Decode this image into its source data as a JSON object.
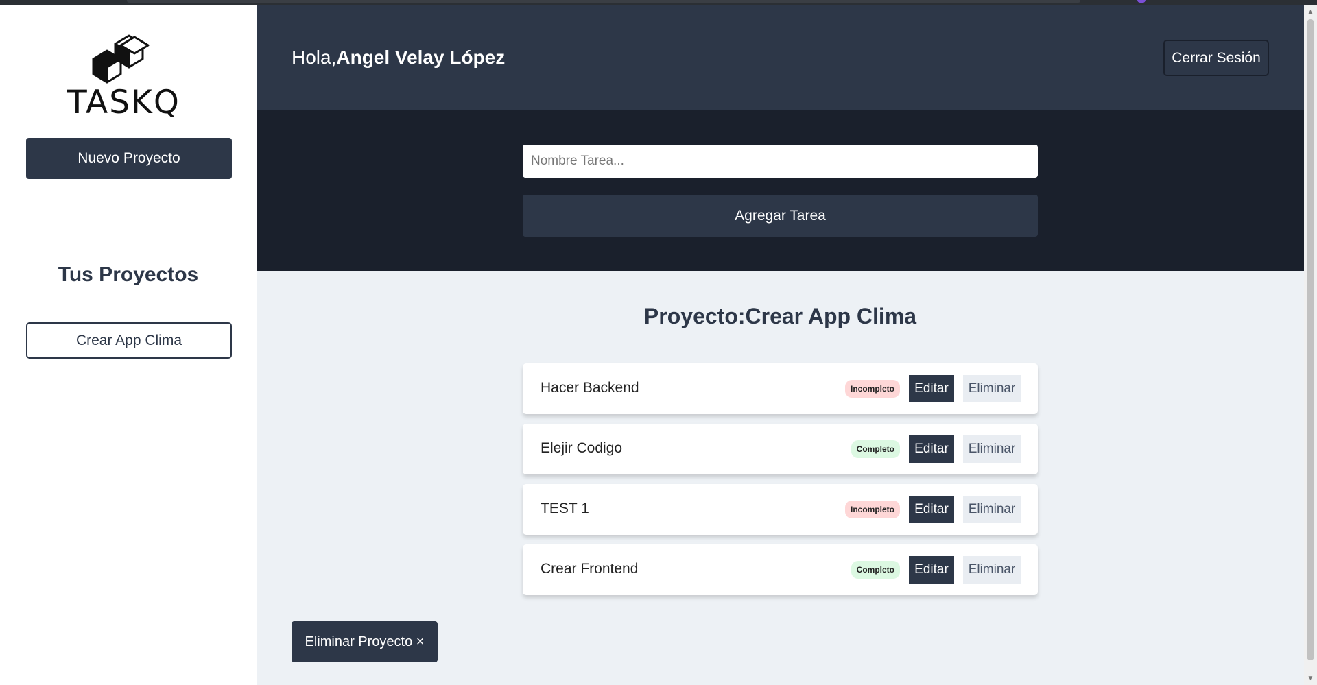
{
  "sidebar": {
    "logo_text": "TASKQ",
    "new_project_label": "Nuevo Proyecto",
    "projects_title": "Tus Proyectos",
    "projects": [
      {
        "name": "Crear App Clima"
      }
    ]
  },
  "header": {
    "greeting_prefix": "Hola,",
    "user_name": "Angel Velay López",
    "logout_label": "Cerrar Sesión"
  },
  "task_form": {
    "input_placeholder": "Nombre Tarea...",
    "input_value": "",
    "submit_label": "Agregar Tarea"
  },
  "project": {
    "title_prefix": "Proyecto:",
    "name": "Crear App Clima",
    "tasks": [
      {
        "name": "Hacer Backend",
        "status": "Incompleto",
        "edit_label": "Editar",
        "delete_label": "Eliminar"
      },
      {
        "name": "Elejir Codigo",
        "status": "Completo",
        "edit_label": "Editar",
        "delete_label": "Eliminar"
      },
      {
        "name": "TEST 1",
        "status": "Incompleto",
        "edit_label": "Editar",
        "delete_label": "Eliminar"
      },
      {
        "name": "Crear Frontend",
        "status": "Completo",
        "edit_label": "Editar",
        "delete_label": "Eliminar"
      }
    ],
    "delete_project_label": "Eliminar Proyecto ×"
  },
  "colors": {
    "primary": "#2d3748",
    "dark": "#1a202c",
    "background": "#edf1f5",
    "incomplete_badge": "#fed7d7",
    "complete_badge": "#dcf8e2"
  },
  "icons": {
    "logo": "cubes-logo-icon",
    "scroll_up": "arrow-up-icon",
    "scroll_down": "arrow-down-icon"
  }
}
